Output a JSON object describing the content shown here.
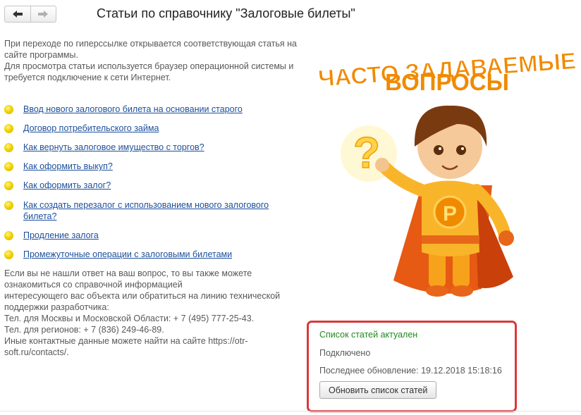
{
  "header": {
    "title": "Статьи по справочнику \"Залоговые билеты\"",
    "back_icon": "arrow-left-icon",
    "forward_icon": "arrow-right-icon"
  },
  "intro": {
    "line1": "При переходе по гиперссылке открывается соответствующая статья на сайте программы.",
    "line2": "Для просмотра статьи используется браузер операционной системы и требуется подключение к сети Интернет."
  },
  "links": [
    "Ввод нового залогового билета на основании старого",
    "Договор потребительского займа",
    "Как вернуть залоговое имущество с торгов?",
    "Как оформить выкуп?",
    "Как оформить залог?",
    "Как создать перезалог с использованием нового залогового билета?",
    "Продление залога",
    "Промежуточные операции с залоговыми билетами"
  ],
  "footer": {
    "line1": "Если вы не нашли ответ на ваш вопрос, то вы также можете ознакомиться со справочной информацией",
    "line2": "интересующего вас объекта или обратиться на линию технической поддержки разработчика:",
    "phone_moscow": "Тел. для Москвы и Московской Области: + 7 (495) 777-25-43.",
    "phone_regions": "Тел. для регионов: + 7 (836) 249-46-89.",
    "contacts": "Иные контактные данные можете найти на сайте https://otr-soft.ru/contacts/."
  },
  "hero": {
    "line1": "ЧАСТО ЗАДАВАЕМЫЕ",
    "line2": "ВОПРОСЫ",
    "question_mark": "?",
    "emblem_letter": "P"
  },
  "status": {
    "actual": "Список статей актуален",
    "connection": "Подключено",
    "last_update": "Последнее обновление: 19.12.2018 15:18:16",
    "refresh_button": "Обновить список статей"
  },
  "colors": {
    "link": "#1c4f9c",
    "status_ok": "#1e8a1e",
    "panel_border": "#d9383a",
    "hero_text": "#f08a00"
  }
}
